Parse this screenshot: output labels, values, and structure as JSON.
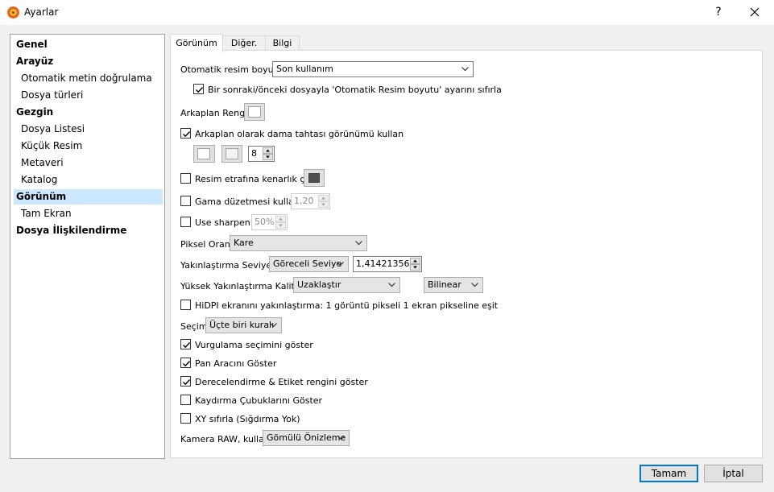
{
  "window": {
    "title": "Ayarlar",
    "help": "?"
  },
  "nav": {
    "items": [
      {
        "label": "Genel",
        "level": "top"
      },
      {
        "label": "Arayüz",
        "level": "top"
      },
      {
        "label": "Otomatik metin doğrulama",
        "level": "sub"
      },
      {
        "label": "Dosya türleri",
        "level": "sub"
      },
      {
        "label": "Gezgin",
        "level": "top"
      },
      {
        "label": "Dosya Listesi",
        "level": "sub"
      },
      {
        "label": "Küçük Resim",
        "level": "sub"
      },
      {
        "label": "Metaveri",
        "level": "sub"
      },
      {
        "label": "Katalog",
        "level": "sub"
      },
      {
        "label": "Görünüm",
        "level": "top",
        "selected": true
      },
      {
        "label": "Tam Ekran",
        "level": "sub"
      },
      {
        "label": "Dosya İlişkilendirme",
        "level": "top"
      }
    ]
  },
  "tabs": [
    "Görünüm",
    "Diğer.",
    "Bilgi"
  ],
  "settings": {
    "auto_size_label": "Otomatik resim boyutu",
    "auto_size_value": "Son kullanım",
    "reset_auto_size_label": "Bir sonraki/önceki dosyayla 'Otomatik Resim boyutu' ayarını sıfırla",
    "reset_auto_size_checked": true,
    "bg_color_label": "Arkaplan Rengi",
    "checker_label": "Arkaplan olarak dama tahtası görünümü kullan",
    "checker_checked": true,
    "checker_size": "8",
    "border_label": "Resim etrafına kenarlık çiz",
    "border_checked": false,
    "border_color": "#505050",
    "gamma_label": "Gama düzetmesi kullan",
    "gamma_checked": false,
    "gamma_value": "1,20",
    "sharpen_label": "Use sharpen",
    "sharpen_checked": false,
    "sharpen_value": "50%",
    "pixel_ratio_label": "Piksel Oranı",
    "pixel_ratio_value": "Kare",
    "zoom_level_label": "Yakınlaştırma Seviyesi",
    "zoom_level_mode": "Göreceli Seviye",
    "zoom_level_value": "1,41421356",
    "hq_zoom_label": "Yüksek Yakınlaştırma Kalitesi",
    "hq_zoom_value": "Uzaklaştır",
    "hq_zoom_filter": "Bilinear",
    "hidpi_label": "HiDPI ekranını yakınlaştırma: 1 görüntü pikseli 1 ekran pikseline eşit",
    "hidpi_checked": false,
    "selection_label": "Seçim",
    "selection_value": "Üçte biri kuralı",
    "highlight_label": "Vurgulama seçimini göster",
    "highlight_checked": true,
    "pan_label": "Pan Aracını Göster",
    "pan_checked": true,
    "rating_label": "Derecelendirme & Etiket rengini göster",
    "rating_checked": true,
    "scrollbars_label": "Kaydırma Çubuklarını Göster",
    "scrollbars_checked": false,
    "xy_reset_label": "XY sıfırla (Sığdırma Yok)",
    "xy_reset_checked": false,
    "camera_raw_label": "Kamera RAW, kullan",
    "camera_raw_value": "Gömülü Önizleme"
  },
  "footer": {
    "ok": "Tamam",
    "cancel": "İptal"
  },
  "colors": {
    "accent": "#0078d7",
    "selection": "#cce8ff"
  }
}
